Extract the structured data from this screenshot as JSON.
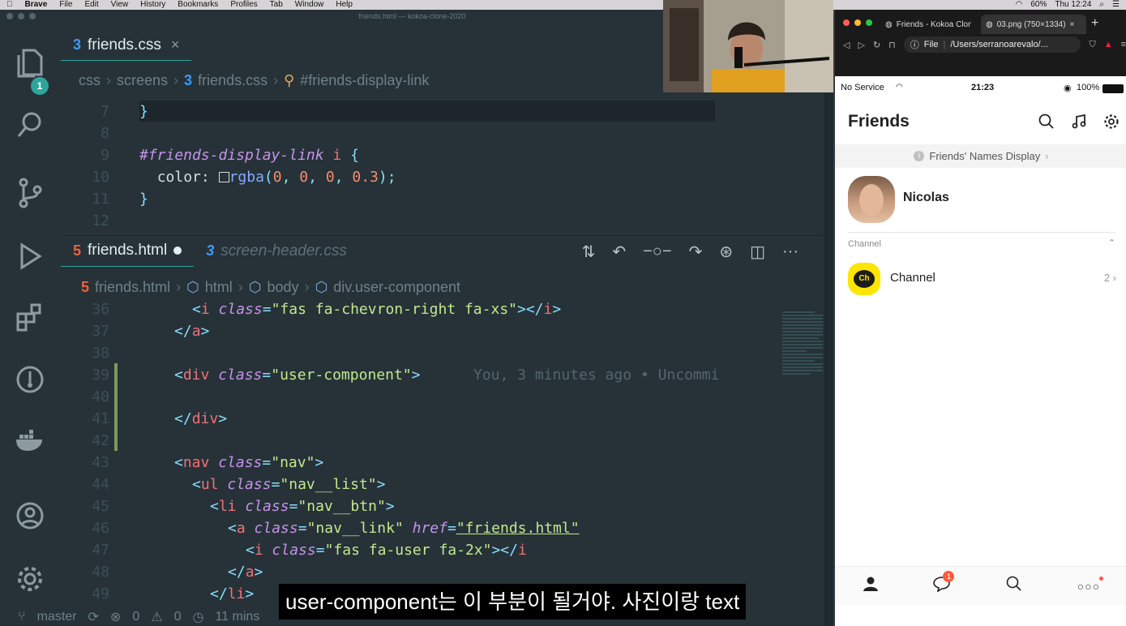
{
  "menubar": {
    "items": [
      "Brave",
      "File",
      "Edit",
      "View",
      "History",
      "Bookmarks",
      "Profiles",
      "Tab",
      "Window",
      "Help"
    ],
    "battery": "60%",
    "clock": "Thu 12:24"
  },
  "vscode": {
    "window_title": "friends.html — kokoa-clone-2020",
    "explorer_badge": "1",
    "top_tab": "friends.css",
    "top_breadcrumb": [
      "css",
      "screens",
      "friends.css",
      "#friends-display-link"
    ],
    "top_lines": [
      {
        "n": "7"
      },
      {
        "n": "8"
      },
      {
        "n": "9"
      },
      {
        "n": "10"
      },
      {
        "n": "11"
      },
      {
        "n": "12"
      }
    ],
    "css_code": {
      "brace_close": "}",
      "selector": "#friends-display-link",
      "selector_tag": "i",
      "open": "{",
      "prop": "color:",
      "fn": "rgba",
      "args": "(0, 0, 0, 0.3);",
      "args_nums": [
        "0",
        "0",
        "0",
        "0.3"
      ]
    },
    "bottom_tabs": {
      "active": "friends.html",
      "inactive": "screen-header.css"
    },
    "bottom_breadcrumb": [
      "friends.html",
      "html",
      "body",
      "div.user-component"
    ],
    "blame": "You, 3 minutes ago • Uncommi",
    "bottom_line_numbers": [
      "36",
      "37",
      "38",
      "39",
      "40",
      "41",
      "42",
      "43",
      "44",
      "45",
      "46",
      "47",
      "48",
      "49"
    ],
    "status": {
      "branch": "master",
      "errors": "0",
      "warnings": "0",
      "time": "11 mins"
    }
  },
  "browser": {
    "tab1": "Friends - Kokoa Clon",
    "tab2": "03.png (750×1334)",
    "address_prefix": "File",
    "address": "/Users/serranoarevalo/..."
  },
  "phone": {
    "carrier": "No Service",
    "time": "21:23",
    "battery": "100%",
    "title": "Friends",
    "names_display": "Friends' Names Display",
    "user_name": "Nicolas",
    "channel_section": "Channel",
    "channel_name": "Channel",
    "channel_logo": "Ch",
    "channel_count": "2",
    "chat_badge": "1"
  },
  "subtitle": "user-component는 이 부분이 될거야. 사진이랑 text"
}
